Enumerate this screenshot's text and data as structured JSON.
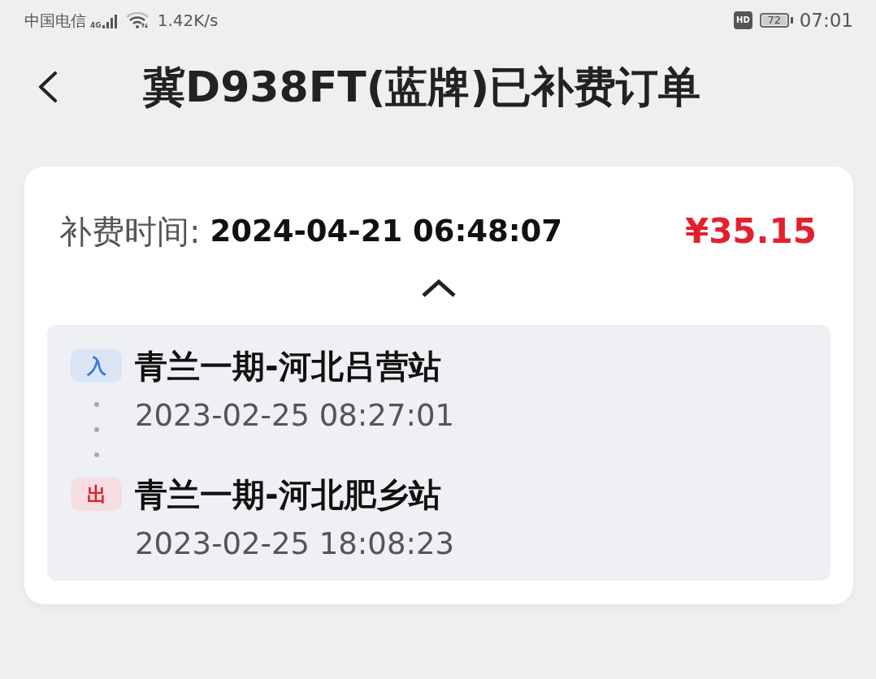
{
  "status_bar": {
    "carrier": "中国电信",
    "network": "4G",
    "speed": "1.42K/s",
    "hd": "HD",
    "battery": "72",
    "time": "07:01"
  },
  "header": {
    "title": "冀D938FT(蓝牌)已补费订单"
  },
  "order": {
    "label": "补费时间:",
    "paid_time": "2024-04-21 06:48:07",
    "amount": "¥35.15",
    "expanded": true,
    "stops": [
      {
        "kind": "entry",
        "badge": "入",
        "station": "青兰一期-河北吕营站",
        "time": "2023-02-25 08:27:01"
      },
      {
        "kind": "exit",
        "badge": "出",
        "station": "青兰一期-河北肥乡站",
        "time": "2023-02-25 18:08:23"
      }
    ]
  }
}
